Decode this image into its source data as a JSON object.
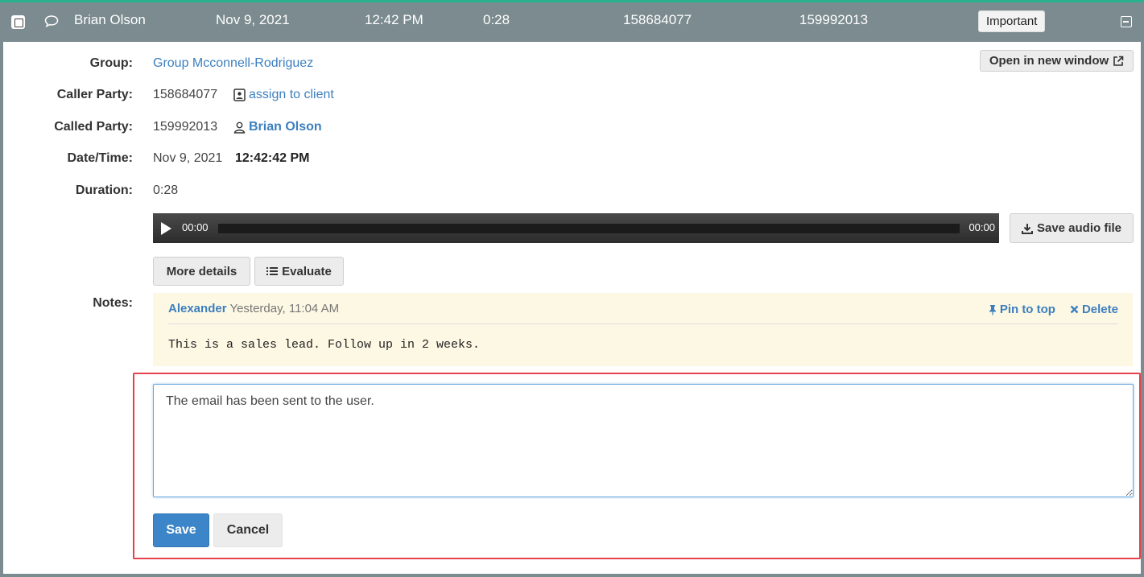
{
  "call_row": {
    "caller_name": "Brian Olson",
    "date": "Nov 9, 2021",
    "time": "12:42 PM",
    "duration": "0:28",
    "caller_number": "158684077",
    "called_number": "159992013",
    "tag": "Important"
  },
  "details": {
    "open_new_window": "Open in new window",
    "group_label": "Group:",
    "group_value": "Group Mcconnell-Rodriguez",
    "caller_label": "Caller Party:",
    "caller_value": "158684077",
    "assign_client": "assign to client",
    "called_label": "Called Party:",
    "called_value": "159992013",
    "called_name": "Brian Olson",
    "datetime_label": "Date/Time:",
    "date_value": "Nov 9, 2021",
    "time_value": "12:42:42 PM",
    "duration_label": "Duration:",
    "duration_value": "0:28"
  },
  "audio": {
    "current": "00:00",
    "total": "00:00",
    "save_label": "Save audio file"
  },
  "buttons": {
    "more_details": "More details",
    "evaluate": "Evaluate",
    "save": "Save",
    "cancel": "Cancel"
  },
  "notes": {
    "label": "Notes:",
    "items": [
      {
        "author": "Alexander",
        "timestamp": "Yesterday, 11:04 AM",
        "pin": "Pin to top",
        "delete": "Delete",
        "text": "This is a sales lead. Follow up in 2 weeks."
      }
    ],
    "new_note_value": "The email has been sent to the user."
  },
  "colors": {
    "header_bg": "#7b8b8f",
    "accent_top": "#29b08f",
    "link": "#3c7fbf",
    "note_bg": "#fdf8e4",
    "highlight": "#e5414b",
    "primary": "#3c85c8"
  },
  "icons": [
    "checkbox-icon",
    "comment-icon",
    "collapse-icon",
    "external-link-icon",
    "contact-card-icon",
    "user-icon",
    "play-icon",
    "download-icon",
    "list-icon",
    "pin-icon",
    "delete-icon",
    "resize-grip-icon"
  ]
}
